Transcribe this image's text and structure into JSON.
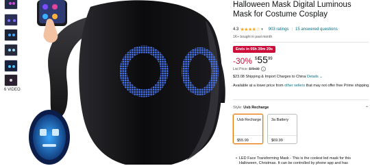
{
  "gallery": {
    "thumbnail_count": 6,
    "video_label": "6 VIDEO"
  },
  "product": {
    "title": "Halloween Mask Digital Luminous Mask for Costume Cosplay",
    "rating_value": "4.3",
    "stars_display": "★★★★☆",
    "ratings_count": "903 ratings",
    "answered_questions": "15 answered questions",
    "bought_text": "1K+ bought in past month"
  },
  "deal": {
    "badge": "Ends in 05h 39m 29s",
    "discount": "-30%",
    "currency": "$",
    "price_whole": "55",
    "price_fraction": "99",
    "list_price_label": "List Price:",
    "list_price": "$79.99"
  },
  "shipping": {
    "text": "$23.08 Shipping & Import Charges to China",
    "details_link": "Details ⌄"
  },
  "availability": {
    "prefix": "Available at a lower price from",
    "link": "other sellers",
    "suffix": "that may not offer free Prime shipping."
  },
  "style": {
    "label": "Style:",
    "selected": "Usb Recharge",
    "options": [
      {
        "name": "Usb Recharge",
        "price": "$55.99",
        "selected": true
      },
      {
        "name": "3a Battery",
        "price": "$69.99",
        "selected": false
      }
    ]
  },
  "bullets": [
    "LED Face Transforming Mask - This is the coolest led mask for this Halloween, Christmas. It can be controlled by phone app and has"
  ],
  "colors": {
    "deal_red": "#CC0C39",
    "link_teal": "#007185",
    "star_orange": "#FFA41C",
    "led_blue": "#4a7bff",
    "selected_border": "#e77600"
  }
}
